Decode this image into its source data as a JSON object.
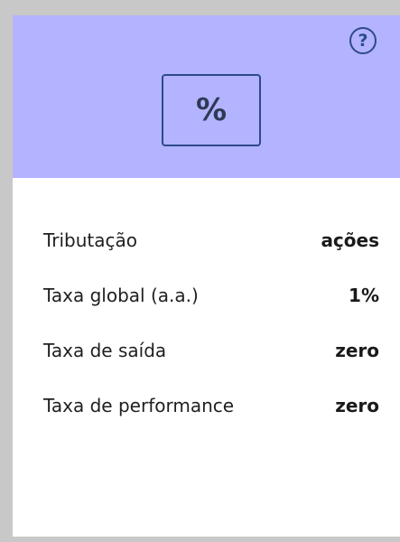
{
  "header": {
    "help_icon": "question-circle-icon",
    "help_glyph": "?",
    "badge_symbol": "%"
  },
  "rows": [
    {
      "label": "Tributação",
      "value": "ações"
    },
    {
      "label": "Taxa global (a.a.)",
      "value": "1%"
    },
    {
      "label": "Taxa de saída",
      "value": "zero"
    },
    {
      "label": "Taxa de performance",
      "value": "zero"
    }
  ],
  "colors": {
    "header_bg": "#b3b3ff",
    "accent": "#2d4a8a",
    "page_bg": "#c8c8c8"
  }
}
